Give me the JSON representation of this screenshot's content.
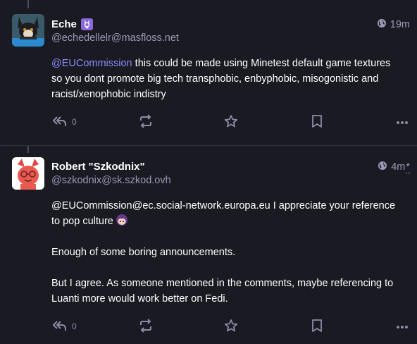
{
  "posts": [
    {
      "display_name": "Eche",
      "account": "@echedellelr@masfloss.net",
      "time": "19m",
      "content": {
        "mention": "@EUCommission",
        "text_lines": [
          " this could be made using Minetest default game textures",
          "so you dont promote big tech transphobic, enbyphobic, misogonistic and",
          "racist/xenophobic indistry"
        ]
      },
      "reply_count": "0"
    },
    {
      "display_name": "Robert \"Szkodnix\"",
      "account": "@szkodnix@sk.szkod.ovh",
      "time": "4m",
      "edited_mark": "*",
      "content": {
        "mention": "@EUCommission@ec.social-network.europa.eu",
        "p1_rest": " I appreciate your reference",
        "p1_line2": "to pop culture",
        "p2": "Enough of some boring announcements.",
        "p3_line1": "But I agree. As someone mentioned in the comments, maybe referencing to",
        "p3_line2": "Luanti more would work better on Fedi."
      },
      "reply_count": "0"
    }
  ],
  "icons": {
    "visibility": "globe-icon",
    "reply": "reply-all-icon",
    "boost": "repeat-icon",
    "favourite": "star-icon",
    "bookmark": "bookmark-icon",
    "more": "more-dots-icon",
    "badge": "gender-symbol-icon"
  },
  "colors": {
    "background": "#1a1a23",
    "mention": "#8c8dff",
    "muted": "#9a9ab8",
    "badge": "#8a68d8"
  }
}
